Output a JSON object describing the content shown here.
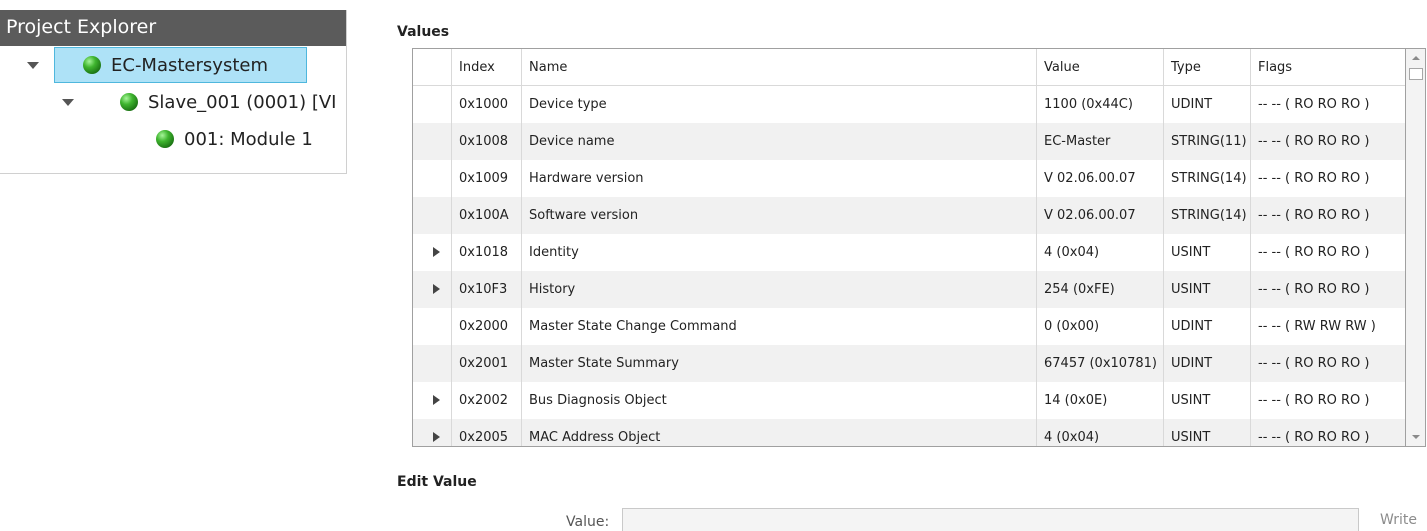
{
  "project_explorer": {
    "title": "Project Explorer",
    "tree": [
      {
        "label": "EC-Mastersystem",
        "expanded": true,
        "selected": true,
        "status": "green"
      },
      {
        "label": "Slave_001 (0001) [VI",
        "expanded": true,
        "selected": false,
        "status": "green"
      },
      {
        "label": "001: Module 1",
        "expanded": false,
        "selected": false,
        "status": "green"
      }
    ]
  },
  "values": {
    "title": "Values",
    "columns": [
      "",
      "Index",
      "Name",
      "Value",
      "Type",
      "Flags"
    ],
    "rows": [
      {
        "expandable": false,
        "index": "0x1000",
        "name": "Device type",
        "value": "1100 (0x44C)",
        "type": "UDINT",
        "flags": "-- -- ( RO RO RO )"
      },
      {
        "expandable": false,
        "index": "0x1008",
        "name": "Device name",
        "value": "EC-Master",
        "type": "STRING(11)",
        "flags": "-- -- ( RO RO RO )"
      },
      {
        "expandable": false,
        "index": "0x1009",
        "name": "Hardware version",
        "value": "V 02.06.00.07",
        "type": "STRING(14)",
        "flags": "-- -- ( RO RO RO )"
      },
      {
        "expandable": false,
        "index": "0x100A",
        "name": "Software version",
        "value": "V 02.06.00.07",
        "type": "STRING(14)",
        "flags": "-- -- ( RO RO RO )"
      },
      {
        "expandable": true,
        "index": "0x1018",
        "name": "Identity",
        "value": "4 (0x04)",
        "type": "USINT",
        "flags": "-- -- ( RO RO RO )"
      },
      {
        "expandable": true,
        "index": "0x10F3",
        "name": "History",
        "value": "254 (0xFE)",
        "type": "USINT",
        "flags": "-- -- ( RO RO RO )"
      },
      {
        "expandable": false,
        "index": "0x2000",
        "name": "Master State Change Command",
        "value": "0 (0x00)",
        "type": "UDINT",
        "flags": "-- -- ( RW RW RW )"
      },
      {
        "expandable": false,
        "index": "0x2001",
        "name": "Master State Summary",
        "value": "67457 (0x10781)",
        "type": "UDINT",
        "flags": "-- -- ( RO RO RO )"
      },
      {
        "expandable": true,
        "index": "0x2002",
        "name": "Bus Diagnosis Object",
        "value": "14 (0x0E)",
        "type": "USINT",
        "flags": "-- -- ( RO RO RO )"
      },
      {
        "expandable": true,
        "index": "0x2005",
        "name": "MAC Address Object",
        "value": "4 (0x04)",
        "type": "USINT",
        "flags": "-- -- ( RO RO RO )"
      }
    ]
  },
  "edit_value": {
    "title": "Edit Value",
    "label": "Value:",
    "input_value": "",
    "write_label": "Write"
  },
  "colors": {
    "header_bg": "#5b5b5b",
    "selection_bg": "#aee2f7",
    "selection_border": "#4fb7dd",
    "status_green": "#3fb52f",
    "alt_row": "#f1f1f1"
  }
}
